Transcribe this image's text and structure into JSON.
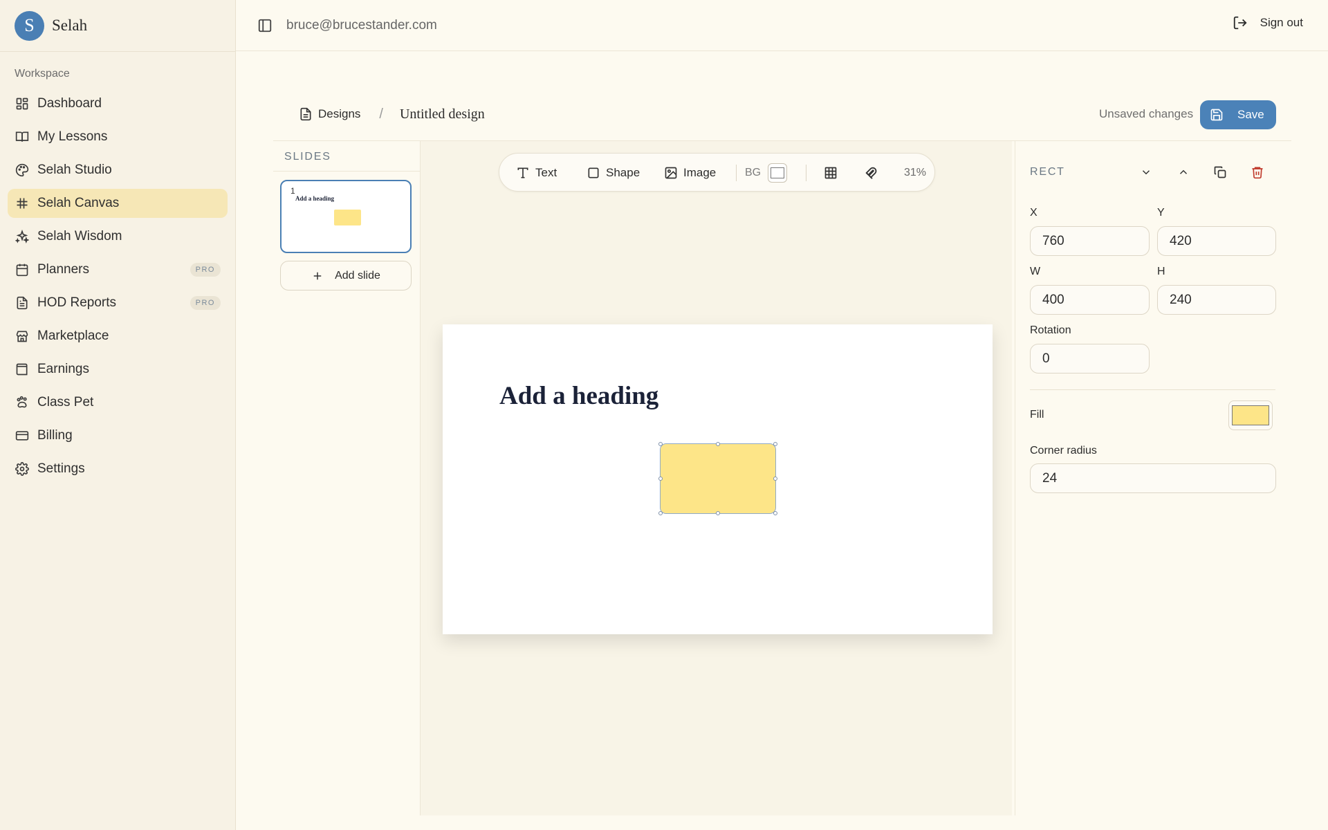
{
  "brand": {
    "logo_letter": "S",
    "name": "Selah"
  },
  "sidebar": {
    "section_label": "Workspace",
    "items": [
      {
        "label": "Dashboard",
        "icon": "dashboard-icon"
      },
      {
        "label": "My Lessons",
        "icon": "book-icon"
      },
      {
        "label": "Selah Studio",
        "icon": "palette-icon"
      },
      {
        "label": "Selah Canvas",
        "icon": "hash-icon",
        "active": true
      },
      {
        "label": "Selah Wisdom",
        "icon": "sparkles-icon"
      },
      {
        "label": "Planners",
        "icon": "calendar-icon",
        "badge": "PRO"
      },
      {
        "label": "HOD Reports",
        "icon": "file-text-icon",
        "badge": "PRO"
      },
      {
        "label": "Marketplace",
        "icon": "store-icon"
      },
      {
        "label": "Earnings",
        "icon": "wallet-icon"
      },
      {
        "label": "Class Pet",
        "icon": "paw-icon"
      },
      {
        "label": "Billing",
        "icon": "credit-card-icon"
      },
      {
        "label": "Settings",
        "icon": "gear-icon"
      }
    ]
  },
  "header": {
    "email": "bruce@brucestander.com",
    "signout_label": "Sign out"
  },
  "breadcrumb": {
    "root": "Designs",
    "separator": "/",
    "title": "Untitled design"
  },
  "status": {
    "unsaved": "Unsaved changes",
    "save_label": "Save"
  },
  "slides_panel": {
    "title": "SLIDES",
    "slides": [
      {
        "number": "1",
        "heading": "Add a heading"
      }
    ],
    "add_label": "Add slide"
  },
  "toolbar": {
    "text_label": "Text",
    "shape_label": "Shape",
    "image_label": "Image",
    "bg_label": "BG",
    "zoom": "31%"
  },
  "slide": {
    "heading": "Add a heading",
    "rect_fill": "#fde588"
  },
  "properties": {
    "type": "RECT",
    "x_label": "X",
    "x_value": "760",
    "y_label": "Y",
    "y_value": "420",
    "w_label": "W",
    "w_value": "400",
    "h_label": "H",
    "h_value": "240",
    "rotation_label": "Rotation",
    "rotation_value": "0",
    "fill_label": "Fill",
    "fill_color": "#fde588",
    "radius_label": "Corner radius",
    "radius_value": "24"
  },
  "colors": {
    "accent": "#4b82b8",
    "active_nav": "#f6e7b6",
    "delete": "#c0392b"
  }
}
